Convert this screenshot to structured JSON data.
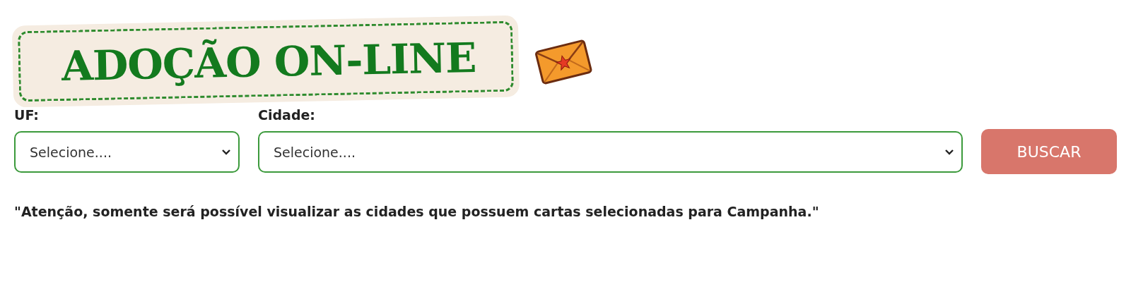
{
  "title": "ADOÇÃO ON-LINE",
  "filters": [
    {
      "label": "UF:",
      "value": "Selecione...."
    },
    {
      "label": "Cidade:",
      "value": "Selecione...."
    }
  ],
  "button": "BUSCAR",
  "notice": "\"Atenção, somente será possível visualizar as cidades que possuem cartas selecionadas para Campanha.\""
}
